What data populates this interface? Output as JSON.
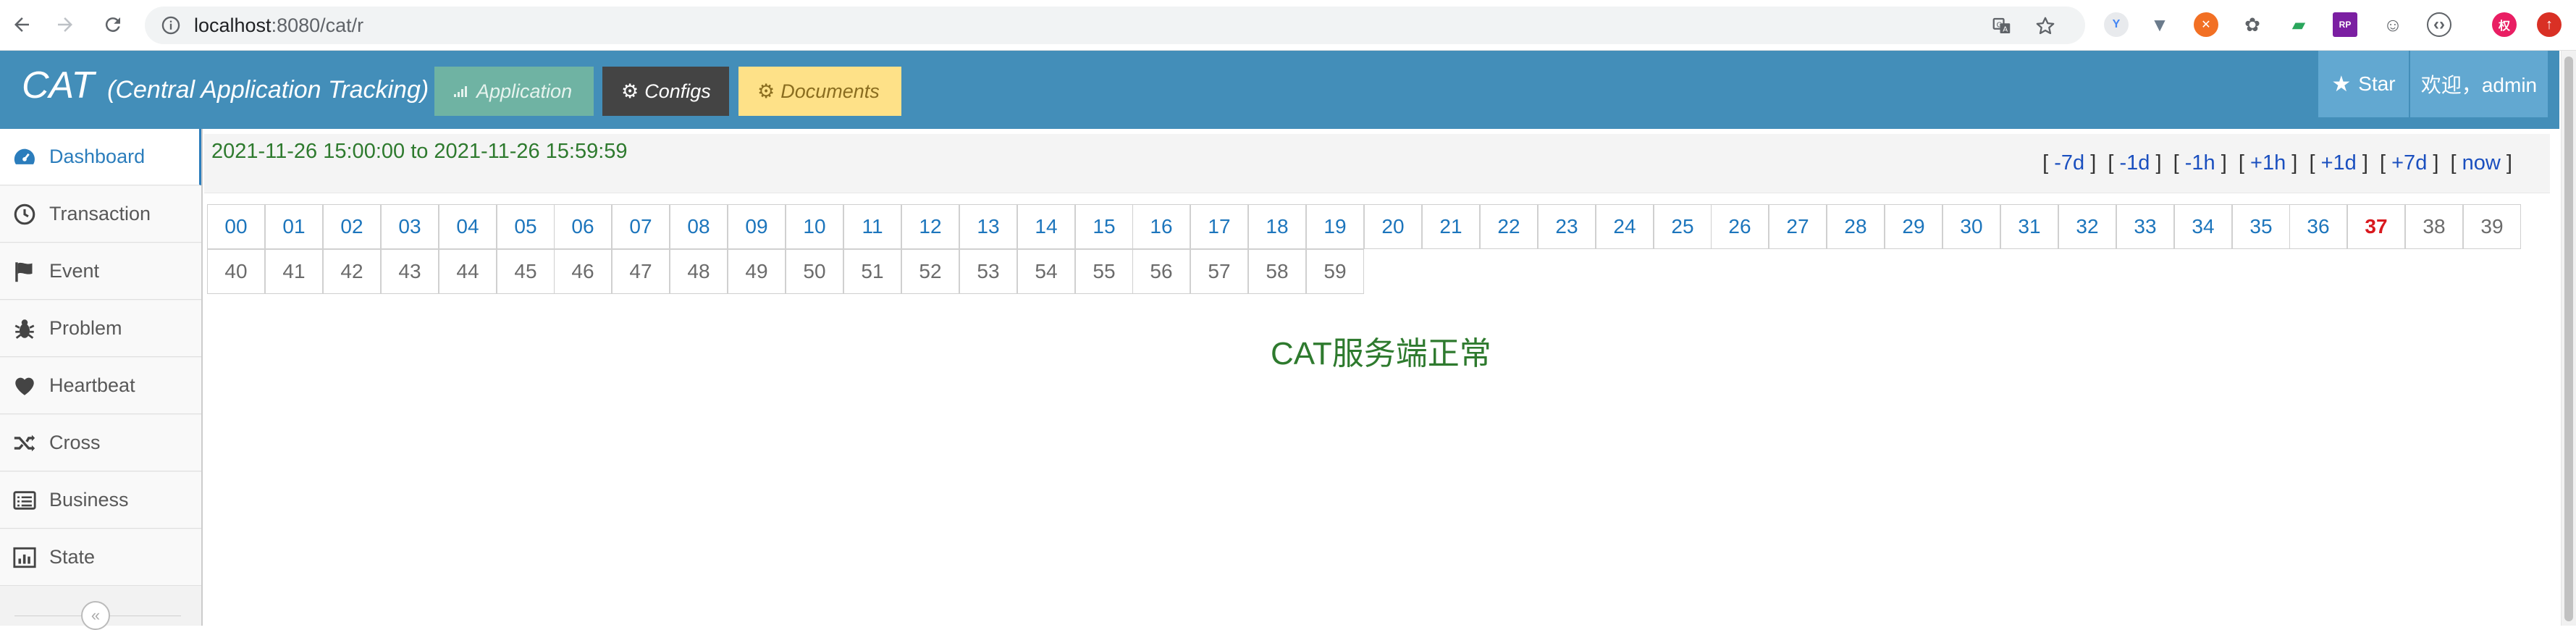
{
  "browser": {
    "url_host": "localhost",
    "url_rest": ":8080/cat/r"
  },
  "header": {
    "brand": "CAT",
    "brand_sub": "(Central Application Tracking)",
    "buttons": {
      "application": "Application",
      "configs": "Configs",
      "documents": "Documents"
    },
    "star": "Star",
    "user": "欢迎，admin"
  },
  "sidebar": {
    "items": [
      {
        "label": "Dashboard",
        "icon": "dashboard-icon"
      },
      {
        "label": "Transaction",
        "icon": "clock-icon"
      },
      {
        "label": "Event",
        "icon": "flag-icon"
      },
      {
        "label": "Problem",
        "icon": "bug-icon"
      },
      {
        "label": "Heartbeat",
        "icon": "heart-icon"
      },
      {
        "label": "Cross",
        "icon": "random-icon"
      },
      {
        "label": "Business",
        "icon": "list-icon"
      },
      {
        "label": "State",
        "icon": "bar-chart-icon"
      }
    ],
    "collapse": "«"
  },
  "main": {
    "time_range": "2021-11-26 15:00:00 to 2021-11-26 15:59:59",
    "quick_links": [
      "-7d",
      "-1d",
      "-1h",
      "+1h",
      "+1d",
      "+7d",
      "now"
    ],
    "minutes": [
      "00",
      "01",
      "02",
      "03",
      "04",
      "05",
      "06",
      "07",
      "08",
      "09",
      "10",
      "11",
      "12",
      "13",
      "14",
      "15",
      "16",
      "17",
      "18",
      "19",
      "20",
      "21",
      "22",
      "23",
      "24",
      "25",
      "26",
      "27",
      "28",
      "29",
      "30",
      "31",
      "32",
      "33",
      "34",
      "35",
      "36",
      "37",
      "38",
      "39",
      "40",
      "41",
      "42",
      "43",
      "44",
      "45",
      "46",
      "47",
      "48",
      "49",
      "50",
      "51",
      "52",
      "53",
      "54",
      "55",
      "56",
      "57",
      "58",
      "59"
    ],
    "current_minute": "37",
    "status": "CAT服务端正常"
  },
  "colors": {
    "header_bg": "#438eb9",
    "link": "#1c75bc",
    "current": "#d9191e",
    "ok_text": "#2e7a2e"
  }
}
